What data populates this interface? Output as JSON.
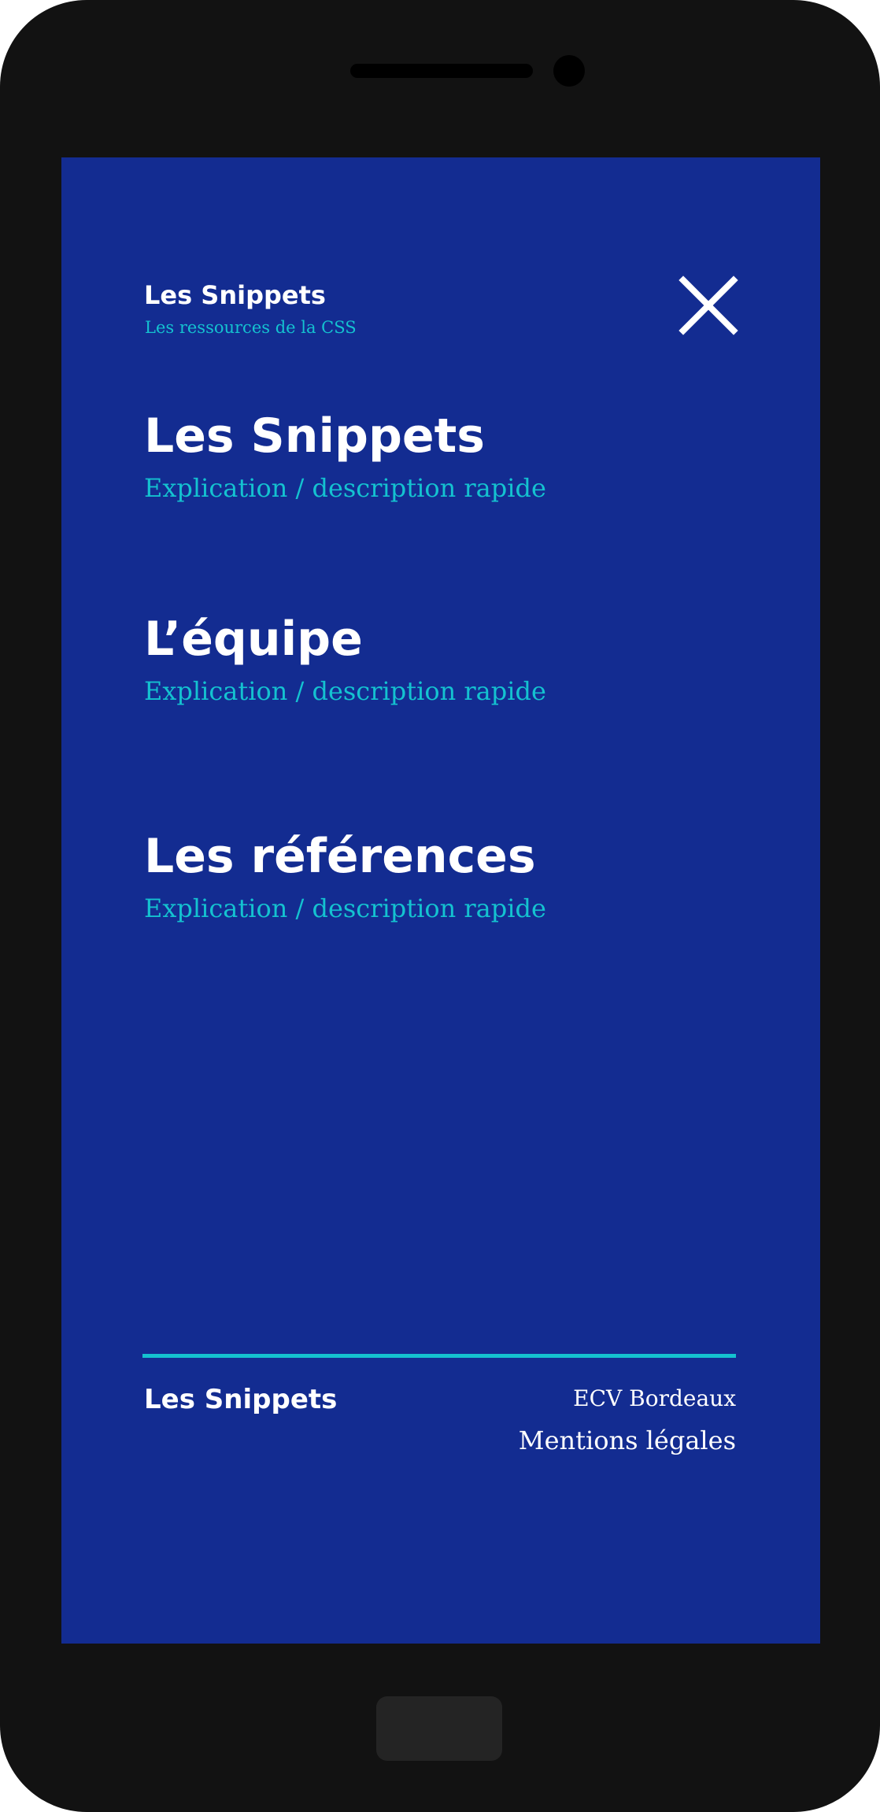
{
  "header": {
    "brand_title": "Les Snippets",
    "brand_subtitle": "Les ressources de la CSS",
    "close_icon": "close-icon"
  },
  "menu": {
    "items": [
      {
        "title": "Les Snippets",
        "description": "Explication / description rapide"
      },
      {
        "title": "L’équipe",
        "description": "Explication / description rapide"
      },
      {
        "title": "Les références",
        "description": "Explication / description rapide"
      }
    ]
  },
  "footer": {
    "brand": "Les Snippets",
    "links": [
      "ECV Bordeaux",
      "Mentions légales"
    ]
  },
  "colors": {
    "device_body": "#121212",
    "screen_background": "#132c91",
    "accent": "#14c2d0",
    "text": "#ffffff"
  }
}
